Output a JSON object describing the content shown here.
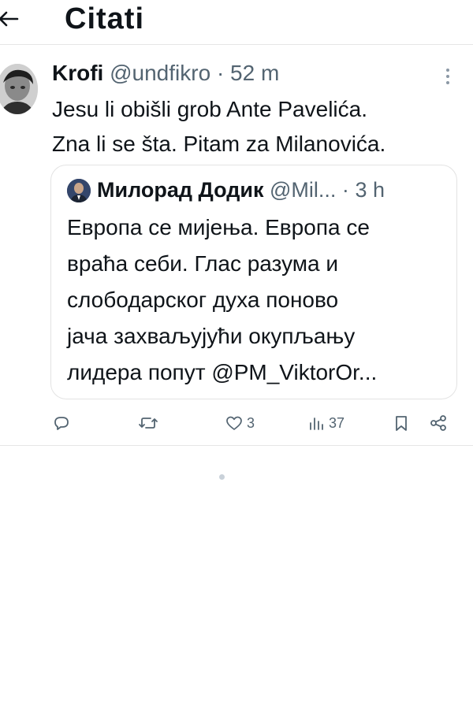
{
  "header": {
    "title": "Citati"
  },
  "tweet": {
    "author_name": "Krofi",
    "author_handle": "@undfikro",
    "separator": "·",
    "time": "52 m",
    "text_line1": "Jesu li obišli grob Ante Pavelića.",
    "text_line2": "Zna li se šta. Pitam za Milanovića.",
    "quote": {
      "author_name": "Милорад Додик",
      "author_handle": "@Mil...",
      "separator": "·",
      "time": "3 h",
      "lines": [
        "Европа се мијења. Европа се",
        "враћа себи. Глас разума и",
        "слободарског духа поново",
        "јача захваљујући окупљању",
        "лидера попут @PM_ViktorOr..."
      ]
    },
    "actions": {
      "likes": "3",
      "views": "37"
    }
  },
  "icons": {
    "back": "arrow-left-icon",
    "more": "more-vertical-icon",
    "reply": "reply-icon",
    "retweet": "retweet-icon",
    "like": "heart-icon",
    "views": "views-icon",
    "bookmark": "bookmark-icon",
    "share": "share-icon"
  },
  "colors": {
    "text": "#0f1419",
    "secondary": "#536471",
    "divider": "#e6e6e6"
  }
}
